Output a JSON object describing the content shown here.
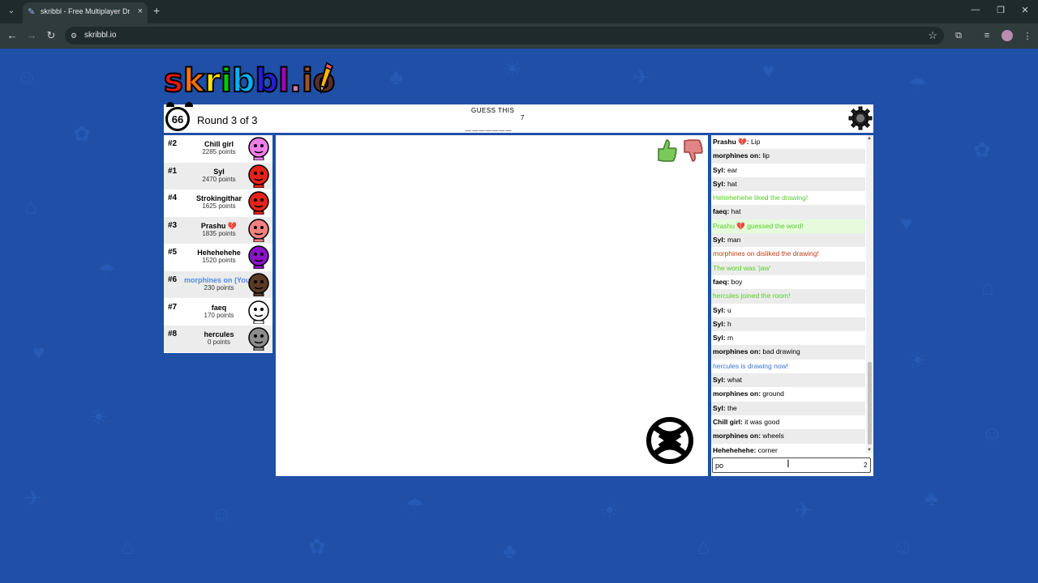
{
  "browser": {
    "tab_title": "skribbl - Free Multiplayer Drawi",
    "url": "skribbl.io",
    "new_tab": "+",
    "tab_close": "×",
    "tab_menu": "⌄",
    "win_min": "—",
    "win_max": "❐",
    "win_close": "✕",
    "back": "←",
    "forward": "→",
    "reload": "↻",
    "star": "☆"
  },
  "logo": {
    "letters": [
      "s",
      "k",
      "r",
      "i",
      "b",
      "b",
      "l",
      ".",
      "i",
      "o"
    ],
    "colors": [
      "#ef130b",
      "#ff7100",
      "#ffe400",
      "#00cc00",
      "#00b2ff",
      "#231fd3",
      "#a300ba",
      "#d37caa",
      "#a0522d",
      "#592f2a"
    ]
  },
  "game": {
    "timer": "66",
    "round_text": "Round 3 of 3",
    "guess_label": "GUESS THIS",
    "word_blanks": "_______",
    "word_length": "7"
  },
  "players": [
    {
      "rank": "#2",
      "name": "Chill girl",
      "points": "2285 points",
      "avatar_color": "#f27ee9"
    },
    {
      "rank": "#1",
      "name": "Syl",
      "points": "2470 points",
      "avatar_color": "#e5221b"
    },
    {
      "rank": "#4",
      "name": "Strokingithar",
      "points": "1625 points",
      "avatar_color": "#e5221b"
    },
    {
      "rank": "#3",
      "name": "Prashu 💔",
      "points": "1835 points",
      "avatar_color": "#f38181"
    },
    {
      "rank": "#5",
      "name": "Hehehehehe",
      "points": "1520 points",
      "avatar_color": "#8a12c7"
    },
    {
      "rank": "#6",
      "name": "morphines on (You)",
      "points": "230 points",
      "avatar_color": "#5a3a25"
    },
    {
      "rank": "#7",
      "name": "faeq",
      "points": "170 points",
      "avatar_color": "#ffffff"
    },
    {
      "rank": "#8",
      "name": "hercules",
      "points": "0 points",
      "avatar_color": "#8c8c8c"
    }
  ],
  "chat": [
    {
      "user": "Prashu 💔:",
      "text": " Lip",
      "style": "normal"
    },
    {
      "user": "morphines on:",
      "text": " lip",
      "style": "normal"
    },
    {
      "user": "Syl:",
      "text": " ear",
      "style": "normal"
    },
    {
      "user": "Syl:",
      "text": " hat",
      "style": "normal"
    },
    {
      "user": "",
      "text": "Hehehehehe liked the drawing!",
      "style": "green"
    },
    {
      "user": "faeq:",
      "text": " hat",
      "style": "normal"
    },
    {
      "user": "",
      "text": "Prashu 💔 guessed the word!",
      "style": "green-bg"
    },
    {
      "user": "Syl:",
      "text": " man",
      "style": "normal"
    },
    {
      "user": "",
      "text": "morphines on disliked the drawing!",
      "style": "red"
    },
    {
      "user": "",
      "text": "The word was 'jaw'",
      "style": "green"
    },
    {
      "user": "faeq:",
      "text": " boy",
      "style": "normal"
    },
    {
      "user": "",
      "text": "hercules joined the room!",
      "style": "green"
    },
    {
      "user": "Syl:",
      "text": " u",
      "style": "normal"
    },
    {
      "user": "Syl:",
      "text": " h",
      "style": "normal"
    },
    {
      "user": "Syl:",
      "text": " m",
      "style": "normal"
    },
    {
      "user": "morphines on:",
      "text": " bad drawing",
      "style": "normal"
    },
    {
      "user": "",
      "text": "hercules is drawing now!",
      "style": "blue"
    },
    {
      "user": "Syl:",
      "text": " what",
      "style": "normal"
    },
    {
      "user": "morphines on:",
      "text": " ground",
      "style": "normal"
    },
    {
      "user": "Syl:",
      "text": " the",
      "style": "normal"
    },
    {
      "user": "Chill girl:",
      "text": " it was good",
      "style": "normal"
    },
    {
      "user": "morphines on:",
      "text": " wheels",
      "style": "normal"
    },
    {
      "user": "Hehehehehe:",
      "text": " corner",
      "style": "normal"
    }
  ],
  "chat_input": {
    "value": "po",
    "count": "2"
  },
  "colors": {
    "background": "#1f4fa6",
    "chat_green": "#56ce27",
    "chat_red": "#c23b14",
    "chat_blue": "#3975ce",
    "you_blue": "#4b8ce8"
  },
  "icons": [
    "tab-favicon-icon",
    "new-tab-icon",
    "back-icon",
    "forward-icon",
    "reload-icon",
    "site-info-icon",
    "star-icon",
    "extensions-icon",
    "media-icon",
    "profile-icon",
    "menu-icon",
    "alarm-clock-icon",
    "settings-gear-icon",
    "thumbs-up-icon",
    "thumbs-down-icon",
    "pencil-icon",
    "text-cursor-icon"
  ]
}
